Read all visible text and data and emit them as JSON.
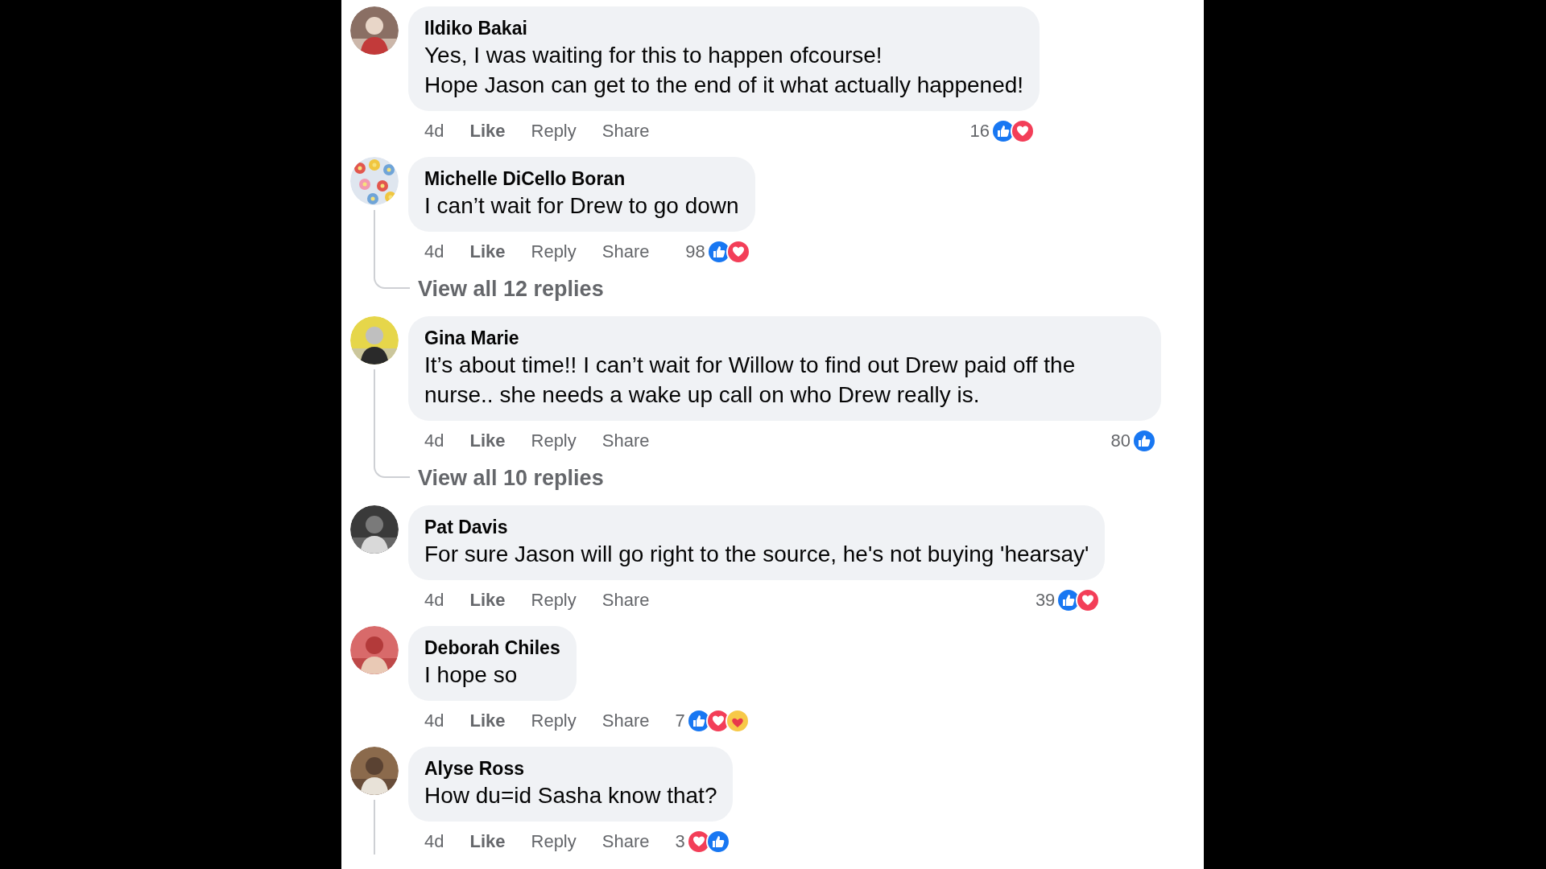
{
  "comments": [
    {
      "author": "Ildiko Bakai",
      "lines": [
        "Yes, I was waiting for this to happen ofcourse!",
        "Hope Jason can get to the end of it what actually happened!"
      ],
      "time": "4d",
      "actions": [
        "Like",
        "Reply",
        "Share"
      ],
      "reaction_count": "16",
      "reactions": [
        {
          "kind": "like"
        },
        {
          "kind": "love"
        }
      ],
      "thread": false
    },
    {
      "author": "Michelle DiCello Boran",
      "lines": [
        "I can’t wait for Drew to go down"
      ],
      "time": "4d",
      "actions": [
        "Like",
        "Reply",
        "Share"
      ],
      "reaction_count": "98",
      "reactions": [
        {
          "kind": "like"
        },
        {
          "kind": "love"
        }
      ],
      "thread": true,
      "view_replies": "View all 12 replies"
    },
    {
      "author": "Gina Marie",
      "lines": [
        "It’s about time!! I can’t wait for Willow to find out Drew paid off the nurse.. she needs a wake up call on who Drew really is."
      ],
      "time": "4d",
      "actions": [
        "Like",
        "Reply",
        "Share"
      ],
      "reaction_count": "80",
      "reactions": [
        {
          "kind": "like"
        }
      ],
      "thread": true,
      "view_replies": "View all 10 replies"
    },
    {
      "author": "Pat Davis",
      "lines": [
        "For sure Jason will go right to the source, he's not buying 'hearsay'"
      ],
      "time": "4d",
      "actions": [
        "Like",
        "Reply",
        "Share"
      ],
      "reaction_count": "39",
      "reactions": [
        {
          "kind": "like"
        },
        {
          "kind": "love"
        }
      ],
      "thread": false
    },
    {
      "author": "Deborah Chiles",
      "lines": [
        "I hope so"
      ],
      "time": "4d",
      "actions": [
        "Like",
        "Reply",
        "Share"
      ],
      "reaction_count": "7",
      "reactions": [
        {
          "kind": "like"
        },
        {
          "kind": "love"
        },
        {
          "kind": "care"
        }
      ],
      "thread": false
    },
    {
      "author": "Alyse Ross",
      "lines": [
        "How du=id Sasha know that?"
      ],
      "time": "4d",
      "actions": [
        "Like",
        "Reply",
        "Share"
      ],
      "reaction_count": "3",
      "reactions": [
        {
          "kind": "love"
        },
        {
          "kind": "like"
        }
      ],
      "thread": true
    }
  ]
}
